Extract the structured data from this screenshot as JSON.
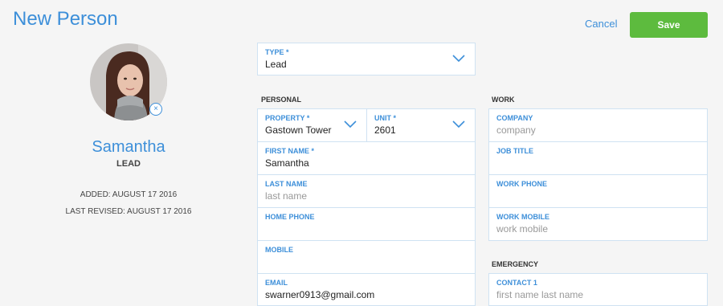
{
  "header": {
    "title": "New Person",
    "cancel_label": "Cancel",
    "save_label": "Save"
  },
  "profile": {
    "name": "Samantha",
    "type": "LEAD",
    "added": "ADDED: AUGUST 17 2016",
    "last_revised": "LAST REVISED: AUGUST 17 2016",
    "remove_photo_glyph": "×"
  },
  "type_field": {
    "label": "TYPE *",
    "value": "Lead"
  },
  "personal": {
    "section_label": "PERSONAL",
    "property": {
      "label": "PROPERTY *",
      "value": "Gastown Tower"
    },
    "unit": {
      "label": "UNIT *",
      "value": "2601"
    },
    "first_name": {
      "label": "FIRST NAME *",
      "value": "Samantha"
    },
    "last_name": {
      "label": "LAST NAME",
      "placeholder": "last name"
    },
    "home_phone": {
      "label": "HOME PHONE",
      "value": ""
    },
    "mobile": {
      "label": "MOBILE",
      "value": ""
    },
    "email": {
      "label": "EMAIL",
      "value": "swarner0913@gmail.com"
    }
  },
  "work": {
    "section_label": "WORK",
    "company": {
      "label": "COMPANY",
      "placeholder": "company"
    },
    "job_title": {
      "label": "JOB TITLE",
      "value": ""
    },
    "work_phone": {
      "label": "WORK PHONE",
      "value": ""
    },
    "work_mobile": {
      "label": "WORK MOBILE",
      "placeholder": "work mobile"
    }
  },
  "emergency": {
    "section_label": "EMERGENCY",
    "contact1": {
      "label": "CONTACT 1",
      "placeholder": "first name last name"
    }
  },
  "colors": {
    "accent": "#3d8fd9",
    "save": "#5dbb3e",
    "field_border": "#cfe2f2"
  },
  "icons": {
    "dropdown": "chevron-down-icon",
    "remove": "close-icon"
  }
}
